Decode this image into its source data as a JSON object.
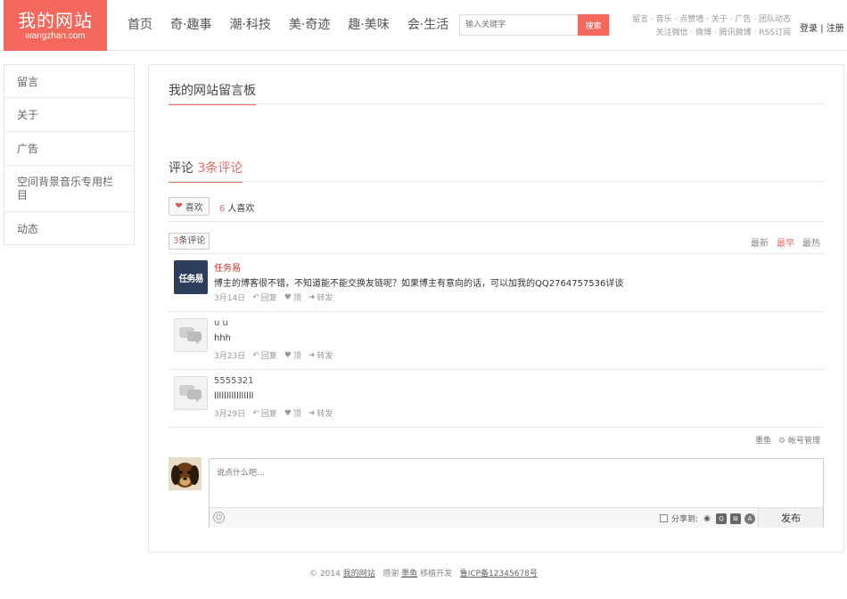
{
  "header": {
    "logo_title": "我的网站",
    "logo_sub": "wangzhan.com",
    "nav": [
      "首页",
      "奇·趣事",
      "潮·科技",
      "美·奇迹",
      "趣·美味",
      "会·生活"
    ],
    "search_placeholder": "输入关键字",
    "search_button": "搜索",
    "toplinks_row1": "留言 · 音乐 · 点赞墙 · 关于 · 广告 · 团队动态",
    "toplinks_row2": "关注微信 · 微博 · 腾讯微博 · RSS订阅",
    "login": "登录",
    "separator": "|",
    "logout": "注册"
  },
  "sidebar": {
    "items": [
      "留言",
      "关于",
      "广告",
      "空间背景音乐专用栏目",
      "动态"
    ]
  },
  "board": {
    "title": "我的网站留言板"
  },
  "comments_section": {
    "title_prefix": "评论",
    "title_count": "3条评论",
    "like_label": "喜欢",
    "like_count": "6",
    "like_suffix": "人喜欢",
    "count_num": "3",
    "count_label": "条评论",
    "sort": [
      "最新",
      "最早",
      "最热"
    ],
    "sort_active": "最早",
    "reply_label": "回复",
    "up_label": "顶",
    "forward_label": "转发",
    "items": [
      {
        "name": "任务易",
        "avatar_text": "任务易",
        "text": "博主的博客很不错，不知道能不能交换友链呢？如果博主有意向的话，可以加我的QQ2764757536详谈",
        "date": "3月14日"
      },
      {
        "name": "u u",
        "text": "hhh",
        "date": "3月23日"
      },
      {
        "name": "5555321",
        "text": "llllllllllllllll",
        "date": "3月29日"
      }
    ],
    "provider": "墨鱼",
    "account_manage": "帐号管理"
  },
  "editor": {
    "placeholder": "说点什么吧…",
    "share_label": "分享到:",
    "publish": "发布"
  },
  "footer": {
    "copyright": "© 2014",
    "site": "我的网站",
    "thanks": "感谢",
    "provider": "墨鱼",
    "ported": "移植开发",
    "icp": "鲁ICP备12345678号"
  }
}
